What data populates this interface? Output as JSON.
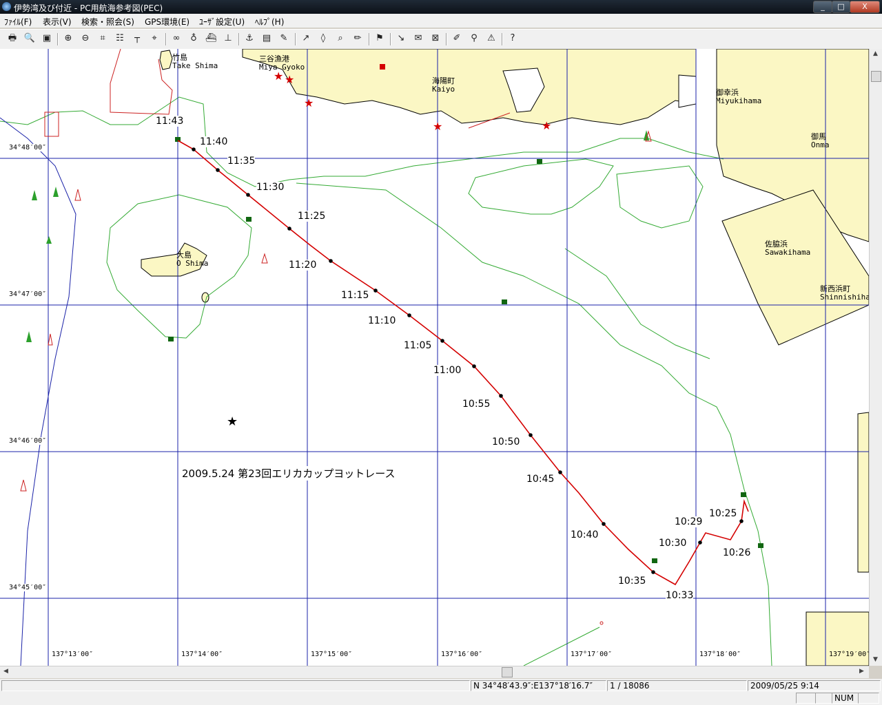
{
  "window": {
    "title": "伊勢湾及び付近 - PC用航海参考図(PEC)",
    "buttons": [
      "_",
      "□",
      "X"
    ]
  },
  "menu": [
    "ﾌｧｲﾙ(F)",
    "表示(V)",
    "検索・照会(S)",
    "GPS環境(E)",
    "ﾕｰｻﾞ設定(U)",
    "ﾍﾙﾌﾟ(H)"
  ],
  "toolbar_icons": [
    "print-icon",
    "print-preview-icon",
    "save-icon",
    "zoom-in-icon",
    "zoom-out-icon",
    "grid-icon",
    "table-icon",
    "ruler-icon",
    "gps-icon",
    "binoculars-icon",
    "buoy-icon",
    "ship-icon",
    "pier-icon",
    "anchor-icon",
    "chart-icon",
    "edit-icon",
    "route-icon",
    "waypoint-icon",
    "search-icon",
    "pen-icon",
    "flag-icon",
    "track-icon",
    "note-icon",
    "compass-icon",
    "marker-icon",
    "find-icon",
    "alert-icon",
    "help-icon"
  ],
  "colors": {
    "land": "#fbf7c4",
    "grid": "#1a22a8",
    "depth_contour": "#33aa33",
    "track": "#d40000",
    "title_bar": "#131c26"
  },
  "map": {
    "caption": "2009.5.24 第23回エリカカップヨットレース",
    "lat_labels": [
      "34°48′00″",
      "34°47′00″",
      "34°46′00″",
      "34°45′00″"
    ],
    "lon_labels": [
      "137°13′00″",
      "137°14′00″",
      "137°15′00″",
      "137°16′00″",
      "137°17′00″",
      "137°18′00″",
      "137°19′00″"
    ],
    "place_names": [
      {
        "jp": "竹島",
        "en": "Take Shima"
      },
      {
        "jp": "三谷漁港",
        "en": "Miya Gyoko"
      },
      {
        "jp": "海陽町",
        "en": "Kaiyo"
      },
      {
        "jp": "御幸浜",
        "en": "Miyukihama"
      },
      {
        "jp": "御馬",
        "en": "Onma"
      },
      {
        "jp": "大島",
        "en": "O Shima"
      },
      {
        "jp": "佐脇浜",
        "en": "Sawakihama"
      },
      {
        "jp": "新西浜町",
        "en": "Shinnishiham"
      }
    ],
    "time_labels": [
      "11:43",
      "11:40",
      "11:35",
      "11:30",
      "11:25",
      "11:20",
      "11:15",
      "11:10",
      "11:05",
      "11:00",
      "10:55",
      "10:50",
      "10:45",
      "10:40",
      "10:35",
      "10:33",
      "10:30",
      "10:29",
      "10:25",
      "10:26"
    ]
  },
  "status": {
    "position": "N 34°48′43.9″:E137°18′16.7″",
    "scale": "1 / 18086",
    "datetime": "2009/05/25  9:14",
    "num": "NUM"
  }
}
